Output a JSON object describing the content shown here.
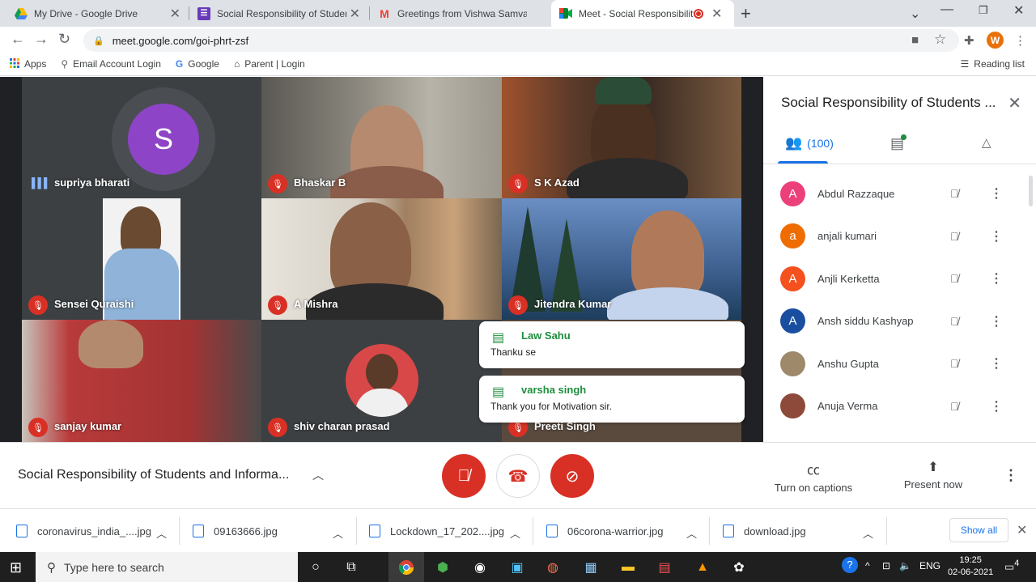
{
  "browser": {
    "tabs": [
      {
        "title": "My Drive - Google Drive",
        "icon": "drive-icon"
      },
      {
        "title": "Social Responsibility of Students",
        "icon": "forms-icon"
      },
      {
        "title": "Greetings from Vishwa Samvad K",
        "icon": "gmail-icon"
      },
      {
        "title": "Meet - Social Responsibility",
        "icon": "meet-icon",
        "active": true
      }
    ],
    "url": "meet.google.com/goi-phrt-zsf",
    "profile_initial": "W",
    "bookmarks": [
      {
        "label": "Apps",
        "icon": "apps-grid-icon"
      },
      {
        "label": "Email Account Login",
        "icon": "search-icon"
      },
      {
        "label": "Google",
        "icon": "google-icon"
      },
      {
        "label": "Parent | Login",
        "icon": "home-icon"
      }
    ],
    "reading_list": "Reading list"
  },
  "meet": {
    "tiles": [
      {
        "name": "supriya bharati",
        "initial": "S",
        "speaking": true
      },
      {
        "name": "Bhaskar B"
      },
      {
        "name": "S K Azad"
      },
      {
        "name": "Sensei Quraishi"
      },
      {
        "name": "A Mishra"
      },
      {
        "name": "Jitendra Kumar"
      },
      {
        "name": "sanjay kumar"
      },
      {
        "name": "shiv charan prasad"
      },
      {
        "name": "Preeti Singh"
      }
    ],
    "chat_toasts": [
      {
        "sender": "Law Sahu",
        "message": "Thanku se"
      },
      {
        "sender": "varsha singh",
        "message": "Thank you for Motivation sir."
      }
    ],
    "panel": {
      "title": "Social Responsibility of Students ...",
      "people_count": "(100)",
      "participants": [
        {
          "name": "Abdul Razzaque",
          "initial": "A",
          "color": "#ec407a"
        },
        {
          "name": "anjali kumari",
          "initial": "a",
          "color": "#ef6c00"
        },
        {
          "name": "Anjli Kerketta",
          "initial": "A",
          "color": "#f4511e"
        },
        {
          "name": "Ansh siddu Kashyap",
          "initial": "A",
          "color": "#1a4fa0"
        },
        {
          "name": "Anshu Gupta",
          "initial": "",
          "color": "#9e8a6a"
        },
        {
          "name": "Anuja Verma",
          "initial": "",
          "color": "#8d4a3a"
        }
      ]
    },
    "controls": {
      "meeting_name": "Social Responsibility of Students and Informa...",
      "captions_label": "Turn on captions",
      "present_label": "Present now"
    }
  },
  "downloads": {
    "items": [
      "coronavirus_india_....jpg",
      "09163666.jpg",
      "Lockdown_17_202....jpg",
      "06corona-warrior.jpg",
      "download.jpg"
    ],
    "show_all": "Show all"
  },
  "taskbar": {
    "search_placeholder": "Type here to search",
    "language": "ENG",
    "time": "19:25",
    "date": "02-06-2021",
    "notification_count": "4"
  }
}
